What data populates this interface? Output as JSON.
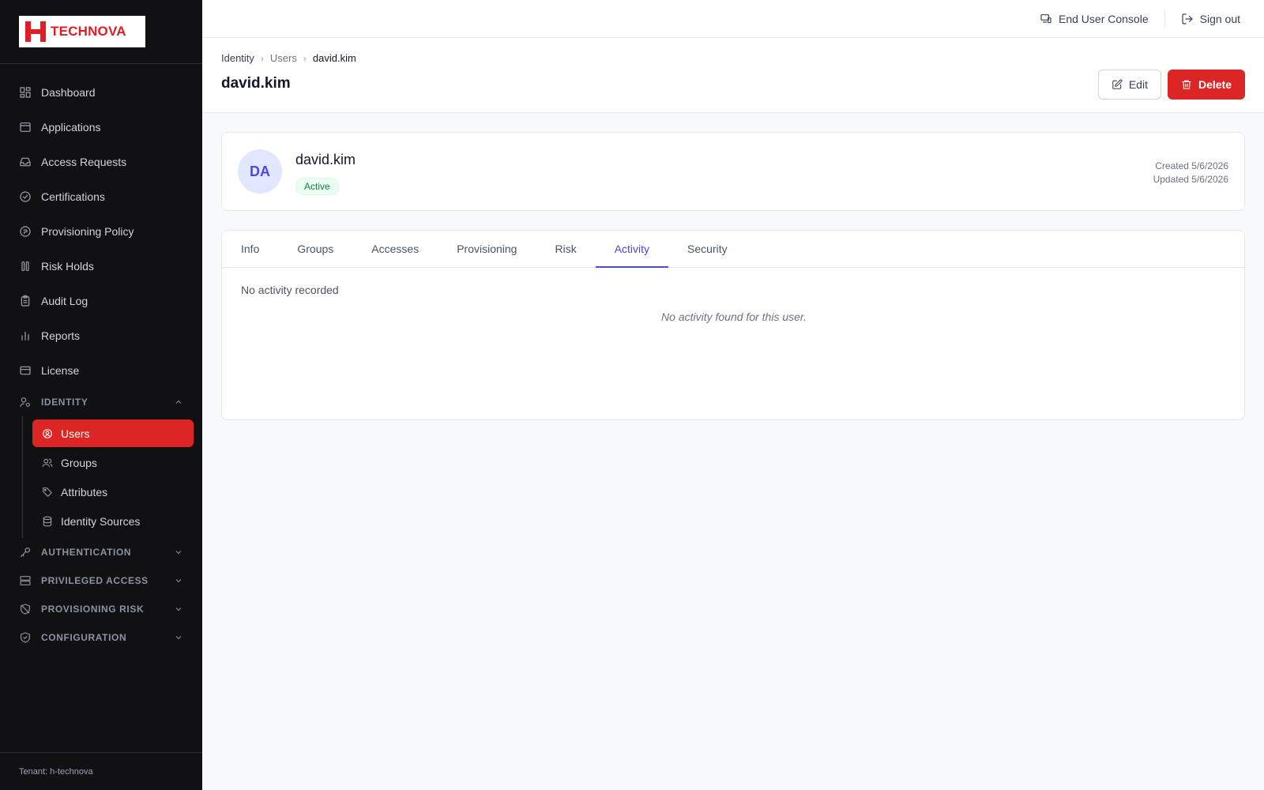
{
  "brand": {
    "name": "TECHNOVA",
    "color": "#e21c24"
  },
  "sidebar": {
    "items": [
      {
        "label": "Dashboard",
        "icon": "dashboard-icon"
      },
      {
        "label": "Applications",
        "icon": "applications-icon"
      },
      {
        "label": "Access Requests",
        "icon": "inbox-icon"
      },
      {
        "label": "Certifications",
        "icon": "check-circle-icon"
      },
      {
        "label": "Provisioning Policy",
        "icon": "policy-icon"
      },
      {
        "label": "Risk Holds",
        "icon": "pause-icon"
      },
      {
        "label": "Audit Log",
        "icon": "clipboard-icon"
      },
      {
        "label": "Reports",
        "icon": "bar-chart-icon"
      },
      {
        "label": "License",
        "icon": "card-icon"
      }
    ],
    "identity_section": {
      "label": "IDENTITY",
      "items": [
        {
          "label": "Users",
          "active": true
        },
        {
          "label": "Groups"
        },
        {
          "label": "Attributes"
        },
        {
          "label": "Identity Sources"
        }
      ]
    },
    "collapsed_sections": [
      {
        "label": "AUTHENTICATION"
      },
      {
        "label": "PRIVILEGED ACCESS"
      },
      {
        "label": "PROVISIONING RISK"
      },
      {
        "label": "CONFIGURATION"
      }
    ],
    "tenant": "Tenant: h-technova"
  },
  "topbar": {
    "end_user_console": "End User Console",
    "sign_out": "Sign out"
  },
  "breadcrumb": [
    "Identity",
    "Users",
    "david.kim"
  ],
  "page_title": "david.kim",
  "actions": {
    "edit": "Edit",
    "delete": "Delete"
  },
  "profile": {
    "initials": "DA",
    "name": "david.kim",
    "status": "Active",
    "created": "Created 5/6/2026",
    "updated": "Updated 5/6/2026"
  },
  "tabs": [
    "Info",
    "Groups",
    "Accesses",
    "Provisioning",
    "Risk",
    "Activity",
    "Security"
  ],
  "active_tab": "Activity",
  "activity": {
    "heading": "No activity recorded",
    "empty_message": "No activity found for this user."
  },
  "colors": {
    "accent": "#4f46e5",
    "danger": "#dc2626",
    "success": "#15803d",
    "sidebar_bg": "#111113"
  }
}
